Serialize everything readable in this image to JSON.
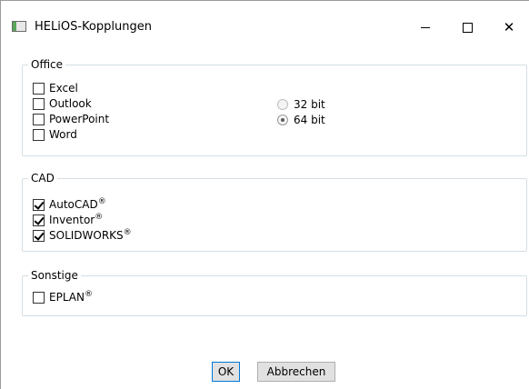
{
  "window": {
    "title": "HELiOS-Kopplungen",
    "controls": {
      "minimize": "minimize-icon",
      "maximize": "maximize-icon",
      "close": "close-icon",
      "close_glyph": "✕"
    }
  },
  "office": {
    "legend": "Office",
    "items": [
      {
        "label": "Excel",
        "checked": false
      },
      {
        "label": "Outlook",
        "checked": false
      },
      {
        "label": "PowerPoint",
        "checked": false
      },
      {
        "label": "Word",
        "checked": false
      }
    ],
    "bitness": [
      {
        "label": "32 bit",
        "selected": false
      },
      {
        "label": "64 bit",
        "selected": true
      }
    ]
  },
  "cad": {
    "legend": "CAD",
    "items": [
      {
        "label": "AutoCAD",
        "mark": "®",
        "checked": true
      },
      {
        "label": "Inventor",
        "mark": "®",
        "checked": true
      },
      {
        "label": "SOLIDWORKS",
        "mark": "®",
        "checked": true
      }
    ]
  },
  "other": {
    "legend": "Sonstige",
    "items": [
      {
        "label": "EPLAN",
        "mark": "®",
        "checked": false
      }
    ]
  },
  "buttons": {
    "ok": "OK",
    "cancel": "Abbrechen"
  },
  "colors": {
    "group_border": "#d5dfe5",
    "default_button_border": "#0078d7",
    "button_bg": "#e1e1e1"
  }
}
